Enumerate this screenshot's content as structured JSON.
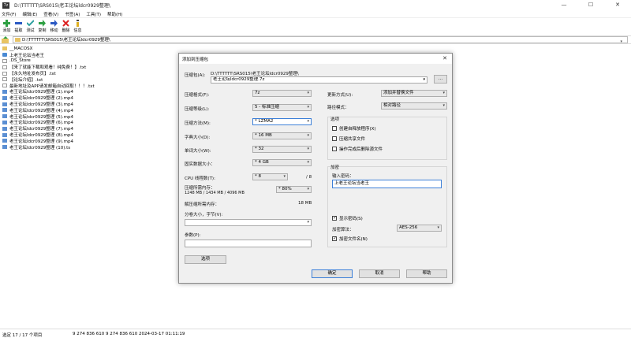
{
  "window": {
    "title": "D:\\TTTTTT\\SRS015\\老王论坛ldcr0929整理\\",
    "app_icon": "7z",
    "minimize": "—",
    "maximize": "☐",
    "close": "✕"
  },
  "menu": [
    "文件(F)",
    "编辑(E)",
    "查看(V)",
    "书签(A)",
    "工具(T)",
    "帮助(H)"
  ],
  "toolbar": [
    "添加",
    "提取",
    "测试",
    "复制",
    "移动",
    "删除",
    "信息"
  ],
  "address": "D:\\TTTTTT\\SRS015\\老王论坛ldcr0929整理\\",
  "files": [
    {
      "name": "__MACOSX",
      "icon": "folder"
    },
    {
      "name": "上老王论坛当老王",
      "icon": "web"
    },
    {
      "name": ".DS_Store",
      "icon": "doc"
    },
    {
      "name": "【来了就能下载和观看！纯免费！】.txt",
      "icon": "doc"
    },
    {
      "name": "【永久地址发布页】.txt",
      "icon": "doc"
    },
    {
      "name": "【论坛介绍】.txt",
      "icon": "doc"
    },
    {
      "name": "最新地址及APP请发邮箱自动回取！！！.txt",
      "icon": "doc"
    },
    {
      "name": "老王论坛ldcr0929整理 (1).mp4",
      "icon": "video"
    },
    {
      "name": "老王论坛ldcr0929整理 (2).mp4",
      "icon": "video"
    },
    {
      "name": "老王论坛ldcr0929整理 (3).mp4",
      "icon": "video"
    },
    {
      "name": "老王论坛ldcr0929整理 (4).mp4",
      "icon": "video"
    },
    {
      "name": "老王论坛ldcr0929整理 (5).mp4",
      "icon": "video"
    },
    {
      "name": "老王论坛ldcr0929整理 (6).mp4",
      "icon": "video"
    },
    {
      "name": "老王论坛ldcr0929整理 (7).mp4",
      "icon": "video"
    },
    {
      "name": "老王论坛ldcr0929整理 (8).mp4",
      "icon": "video"
    },
    {
      "name": "老王论坛ldcr0929整理 (9).mp4",
      "icon": "video"
    },
    {
      "name": "老王论坛ldcr0929整理 (10).ts",
      "icon": "video"
    }
  ],
  "status": {
    "selection": "选定 17 / 17 个项目",
    "size": "9 274 836 610",
    "size2": "9 274 836 610",
    "date": "2024-03-17 01:11:19"
  },
  "dialog": {
    "title": "添加到压缩包",
    "close": "✕",
    "archive_label": "压缩包(A):",
    "archive_path": "D:\\TTTTTT\\SRS015\\老王论坛ldcr0929整理\\",
    "archive_name": "老王论坛ldcr0929整理.7z",
    "browse": "...",
    "format_label": "压缩格式(F):",
    "format_value": "7z",
    "level_label": "压缩等级(L):",
    "level_value": "5 - 标准压缩",
    "method_label": "压缩方法(M):",
    "method_value": "* LZMA2",
    "dict_label": "字典大小(D):",
    "dict_value": "* 16 MB",
    "word_label": "单词大小(W):",
    "word_value": "* 32",
    "solid_label": "固实数据大小：",
    "solid_value": "* 4 GB",
    "cpu_label": "CPU 线程数(T):",
    "cpu_value": "* 8",
    "cpu_total": "/ 8",
    "mem_label": "压缩所需内存：",
    "mem_detail": "1248 MB / 1434 MB / 4096 MB",
    "mem_value": "* 80%",
    "decomp_label": "解压缩所需内存：",
    "decomp_value": "18 MB",
    "split_label": "分卷大小，字节(V):",
    "params_label": "参数(P):",
    "options_button": "选项",
    "update_label": "更新方式(U):",
    "update_value": "添加并替换文件",
    "path_label": "路径模式：",
    "path_value": "相对路径",
    "options_group": "选项",
    "sfx": "创建自释放程序(X)",
    "shared": "压缩共享文件",
    "delete_after": "操作完成后删除源文件",
    "encrypt_group": "加密",
    "password_label": "输入密码：",
    "password_value": "上老王论坛当老王",
    "show_password": "显示密码(S)",
    "enc_method_label": "加密算法：",
    "enc_method_value": "AES-256",
    "encrypt_names": "加密文件名(N)",
    "ok": "确定",
    "cancel": "取消",
    "help": "帮助"
  }
}
